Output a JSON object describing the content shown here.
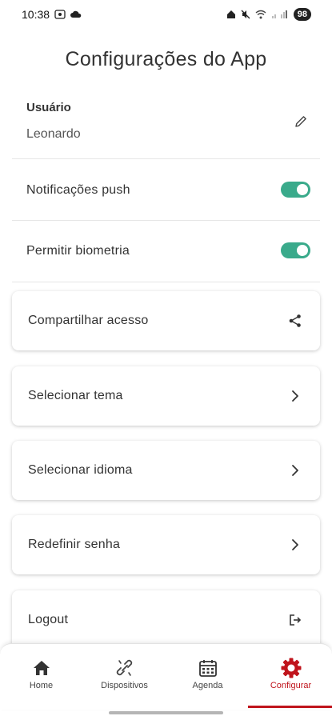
{
  "status_bar": {
    "time": "10:38",
    "battery": "98"
  },
  "page": {
    "title": "Configurações do App"
  },
  "user": {
    "label": "Usuário",
    "value": "Leonardo"
  },
  "toggles": [
    {
      "label": "Notificações push",
      "enabled": true
    },
    {
      "label": "Permitir biometria",
      "enabled": true
    }
  ],
  "cards": [
    {
      "label": "Compartilhar acesso",
      "icon": "share-icon"
    },
    {
      "label": "Selecionar tema",
      "icon": "chevron-right-icon"
    },
    {
      "label": "Selecionar idioma",
      "icon": "chevron-right-icon"
    },
    {
      "label": "Redefinir senha",
      "icon": "chevron-right-icon"
    },
    {
      "label": "Logout",
      "icon": "logout-icon"
    }
  ],
  "nav": {
    "items": [
      {
        "label": "Home",
        "icon": "home-icon"
      },
      {
        "label": "Dispositivos",
        "icon": "link-off-icon"
      },
      {
        "label": "Agenda",
        "icon": "calendar-icon"
      },
      {
        "label": "Configurar",
        "icon": "gear-icon"
      }
    ],
    "active": "Configurar"
  },
  "colors": {
    "accent": "#c0141c",
    "toggle": "#3aaa8b"
  }
}
